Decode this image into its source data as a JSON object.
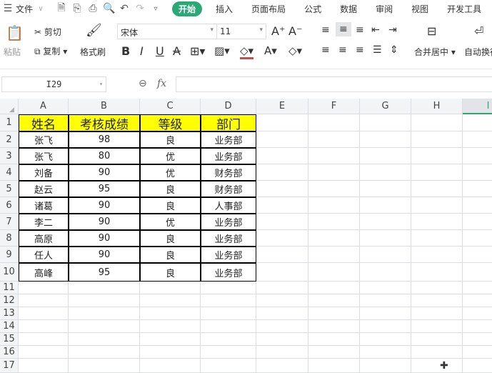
{
  "menubar": {
    "file": "文件",
    "tabs": [
      "开始",
      "插入",
      "页面布局",
      "公式",
      "数据",
      "审阅",
      "视图",
      "开发工具"
    ]
  },
  "ribbon": {
    "paste": "粘贴",
    "cut": "剪切",
    "copy": "复制",
    "format_painter": "格式刷",
    "font": "宋体",
    "size": "11",
    "merge": "合并居中",
    "wrap": "自动换行"
  },
  "formula_bar": {
    "name_box": "I29",
    "fx": "fx",
    "value": ""
  },
  "columns": [
    "A",
    "B",
    "C",
    "D",
    "E",
    "F",
    "G",
    "H",
    "I"
  ],
  "rows": [
    "1",
    "2",
    "3",
    "4",
    "5",
    "6",
    "7",
    "8",
    "9",
    "10",
    "11",
    "12",
    "13",
    "14",
    "15",
    "16",
    "17"
  ],
  "table": {
    "headers": [
      "姓名",
      "考核成绩",
      "等级",
      "部门"
    ],
    "data": [
      [
        "张飞",
        "98",
        "良",
        "业务部"
      ],
      [
        "张飞",
        "80",
        "优",
        "业务部"
      ],
      [
        "刘备",
        "90",
        "优",
        "财务部"
      ],
      [
        "赵云",
        "95",
        "良",
        "财务部"
      ],
      [
        "诸葛",
        "90",
        "良",
        "人事部"
      ],
      [
        "李二",
        "90",
        "优",
        "业务部"
      ],
      [
        "高原",
        "90",
        "良",
        "业务部"
      ],
      [
        "任人",
        "90",
        "良",
        "业务部"
      ],
      [
        "高峰",
        "95",
        "良",
        "业务部"
      ]
    ]
  }
}
